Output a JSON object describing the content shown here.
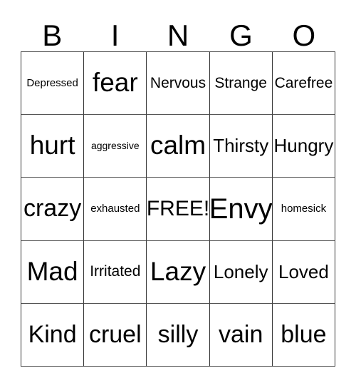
{
  "card": {
    "title": "BINGO",
    "headers": [
      "B",
      "I",
      "N",
      "G",
      "O"
    ],
    "rows": [
      [
        {
          "label": "Depressed",
          "size": "fs-s"
        },
        {
          "label": "fear",
          "size": "fs-xxxl"
        },
        {
          "label": "Nervous",
          "size": "fs-m"
        },
        {
          "label": "Strange",
          "size": "fs-m"
        },
        {
          "label": "Carefree",
          "size": "fs-m"
        }
      ],
      [
        {
          "label": "hurt",
          "size": "fs-xxxl"
        },
        {
          "label": "aggressive",
          "size": "fs-xs"
        },
        {
          "label": "calm",
          "size": "fs-xxxl"
        },
        {
          "label": "Thirsty",
          "size": "fs-l"
        },
        {
          "label": "Hungry",
          "size": "fs-l"
        }
      ],
      [
        {
          "label": "crazy",
          "size": "fs-xxl"
        },
        {
          "label": "exhausted",
          "size": "fs-s"
        },
        {
          "label": "FREE!",
          "size": "fs-xl"
        },
        {
          "label": "Envy",
          "size": "fs-huge"
        },
        {
          "label": "homesick",
          "size": "fs-s"
        }
      ],
      [
        {
          "label": "Mad",
          "size": "fs-xxxl"
        },
        {
          "label": "Irritated",
          "size": "fs-m"
        },
        {
          "label": "Lazy",
          "size": "fs-xxxl"
        },
        {
          "label": "Lonely",
          "size": "fs-l"
        },
        {
          "label": "Loved",
          "size": "fs-l"
        }
      ],
      [
        {
          "label": "Kind",
          "size": "fs-xxl"
        },
        {
          "label": "cruel",
          "size": "fs-xxl"
        },
        {
          "label": "silly",
          "size": "fs-xxl"
        },
        {
          "label": "vain",
          "size": "fs-xxl"
        },
        {
          "label": "blue",
          "size": "fs-xxl"
        }
      ]
    ],
    "free_space": {
      "row": 2,
      "column": 2,
      "label": "FREE!"
    },
    "colors": {
      "background": "#ffffff",
      "text": "#000000",
      "grid_line": "#333333"
    }
  }
}
